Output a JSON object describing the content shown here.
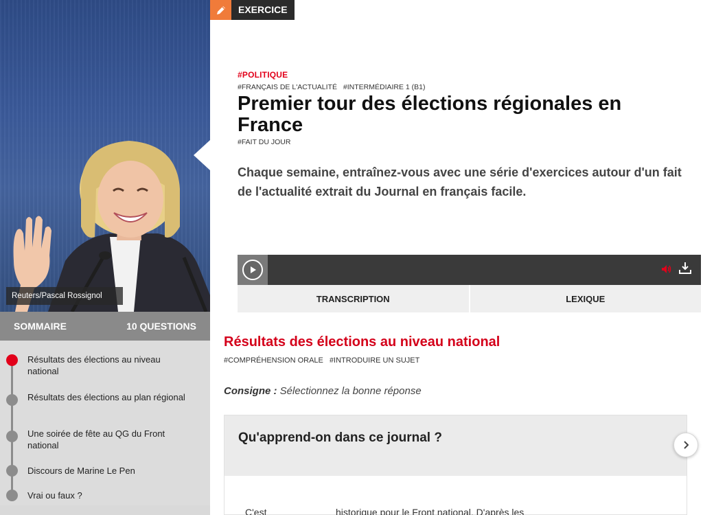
{
  "badge": {
    "label": "EXERCICE",
    "icon": "pencil-icon"
  },
  "photo": {
    "credit": "Reuters/Pascal Rossignol"
  },
  "header": {
    "tag_primary": "#POLITIQUE",
    "tags_secondary": [
      "#FRANÇAIS DE L'ACTUALITÉ",
      "#INTERMÉDIAIRE 1 (B1)"
    ],
    "title": "Premier tour des élections régionales en France",
    "tag_category": "#FAIT DU JOUR",
    "intro": "Chaque semaine, entraînez-vous avec une série d'exercices autour d'un fait de l'actualité extrait du Journal en français facile."
  },
  "player": {
    "play_icon": "play-icon",
    "volume_icon": "volume-icon",
    "download_icon": "download-icon"
  },
  "tabs": [
    {
      "label": "TRANSCRIPTION"
    },
    {
      "label": "LEXIQUE"
    }
  ],
  "sommaire": {
    "title": "SOMMAIRE",
    "count": "10 QUESTIONS",
    "items": [
      {
        "label": "Résultats des élections au niveau national",
        "active": true
      },
      {
        "label": "Résultats des élections au plan régional",
        "active": false
      },
      {
        "label": "Une soirée de fête au QG du Front national",
        "active": false
      },
      {
        "label": "Discours de Marine Le Pen",
        "active": false
      },
      {
        "label": "Vrai ou faux ?",
        "active": false
      }
    ]
  },
  "section": {
    "title": "Résultats des élections au niveau national",
    "tags": [
      "#COMPRÉHENSION ORALE",
      "#INTRODUIRE UN SUJET"
    ],
    "consigne_label": "Consigne :",
    "consigne_text": "Sélectionnez la bonne réponse",
    "question": "Qu'apprend-on dans ce journal ?",
    "answer_start": "C'est",
    "answer_end": "historique pour le Front national. D'après les"
  },
  "colors": {
    "accent": "#e2001a",
    "badge_pen": "#f07b3a",
    "badge_dark": "#2b2b2b",
    "player": "#3a3a3a"
  }
}
